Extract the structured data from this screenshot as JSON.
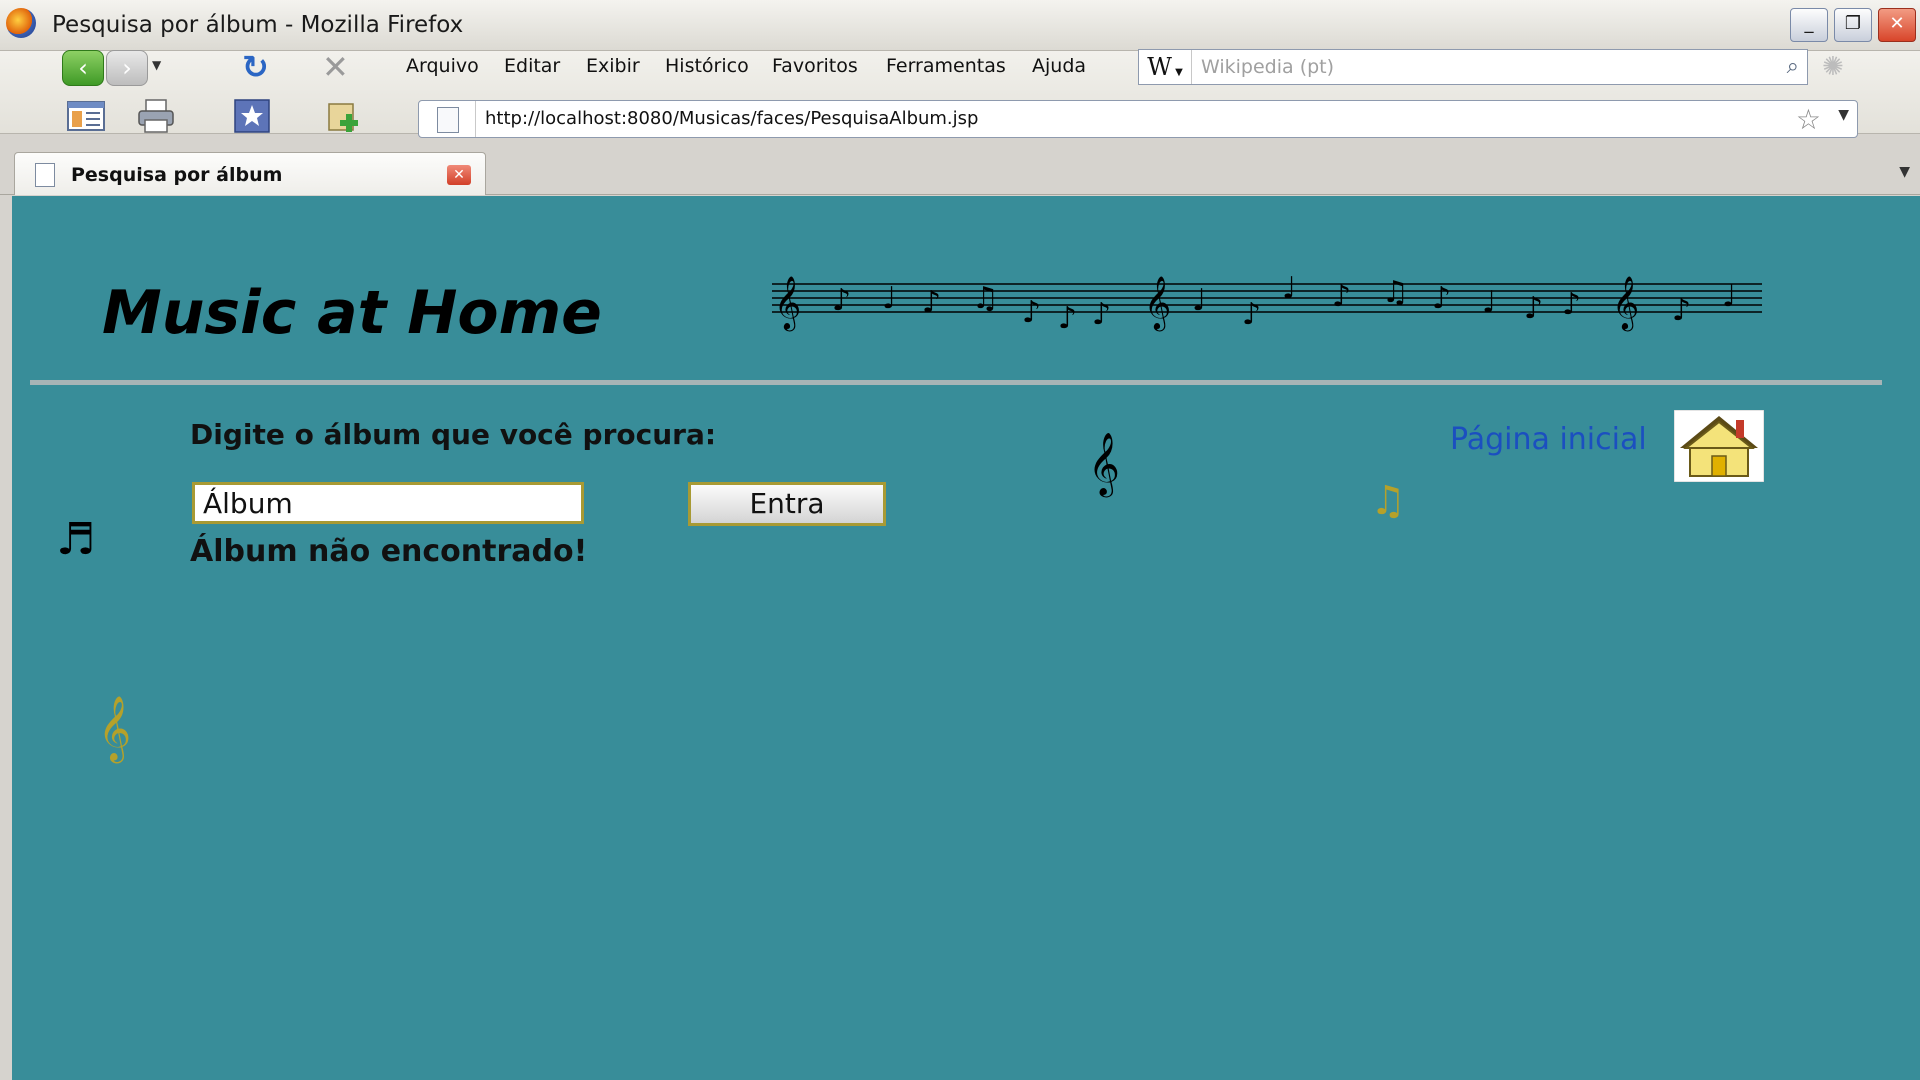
{
  "window": {
    "title": "Pesquisa por álbum - Mozilla Firefox",
    "minimize": "_",
    "restore": "❐",
    "close": "✕"
  },
  "menu": {
    "items": [
      "Arquivo",
      "Editar",
      "Exibir",
      "Histórico",
      "Favoritos",
      "Ferramentas",
      "Ajuda"
    ]
  },
  "search": {
    "engine": "W",
    "placeholder": "Wikipedia (pt)"
  },
  "address": {
    "url": "http://localhost:8080/Musicas/faces/PesquisaAlbum.jsp"
  },
  "tab": {
    "label": "Pesquisa por álbum"
  },
  "page": {
    "site_title": "Music at Home",
    "prompt": "Digite o álbum que você procura:",
    "input_value": "Álbum",
    "submit_label": "Entra",
    "message": "Álbum não encontrado!",
    "home_link": "Página inicial",
    "background": "#388d99",
    "link_color": "#1b4fc0"
  }
}
